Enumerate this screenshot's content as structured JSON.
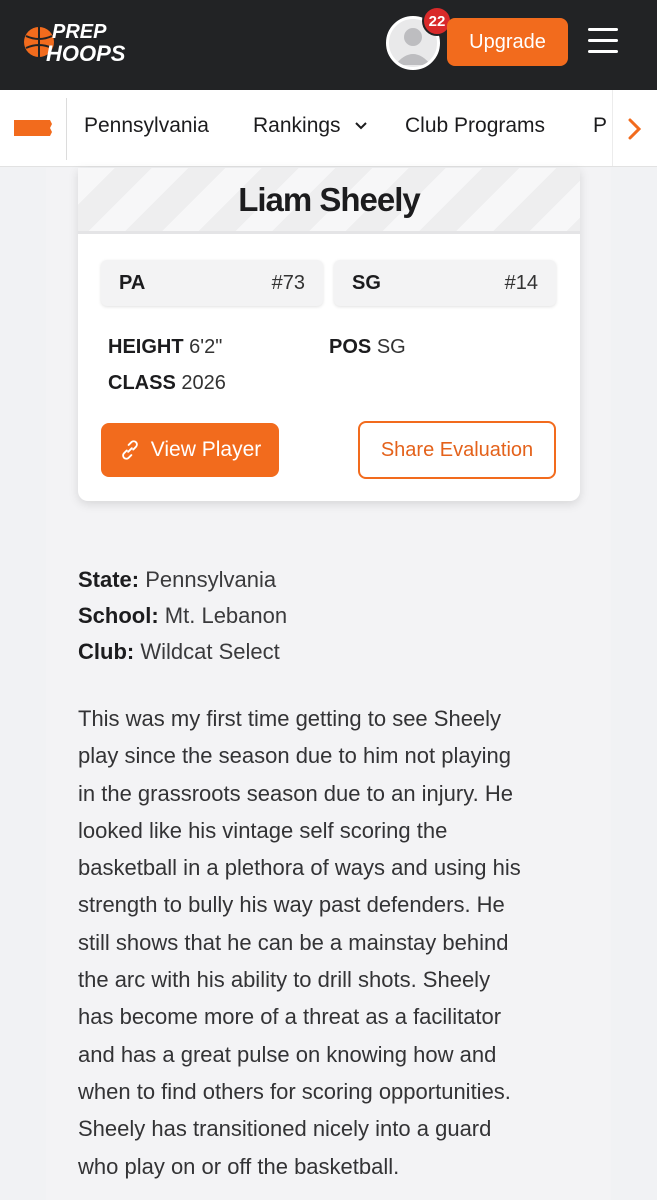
{
  "header": {
    "logo_line1": "PREP",
    "logo_line2": "HOOPS",
    "notification_count": "22",
    "upgrade_label": "Upgrade",
    "brand_color": "#f26b1d",
    "bar_color": "#222325"
  },
  "nav": {
    "items": [
      "Pennsylvania",
      "Rankings",
      "Club Programs",
      "P"
    ],
    "rankings_has_dropdown": true
  },
  "player": {
    "name": "Liam Sheely",
    "state_chip": {
      "label": "PA",
      "rank": "#73"
    },
    "pos_chip": {
      "label": "SG",
      "rank": "#14"
    },
    "height_label": "HEIGHT",
    "height_value": "6'2\"",
    "class_label": "CLASS",
    "class_value": "2026",
    "pos_label": "POS",
    "pos_value": "SG",
    "view_button": "View Player",
    "share_button": "Share Evaluation"
  },
  "details": {
    "state_label": "State:",
    "state_value": "Pennsylvania",
    "school_label": "School:",
    "school_value": "Mt. Lebanon",
    "club_label": "Club:",
    "club_value": "Wildcat Select"
  },
  "evaluation": {
    "lines": [
      "This was my first time getting to see Sheely",
      "play since the season due to him not playing",
      "in the grassroots season due to an injury. He",
      "looked like his vintage self scoring the",
      "basketball in a plethora of ways and using his",
      "strength to bully his way past defenders. He",
      "still shows that he can be a mainstay behind",
      "the arc with his ability to drill shots. Sheely",
      "has become more of a threat as a facilitator",
      "and has a great pulse on knowing how and",
      "when to find others for scoring opportunities.",
      "Sheely has transitioned nicely into a guard",
      "who play on or off the basketball."
    ]
  }
}
